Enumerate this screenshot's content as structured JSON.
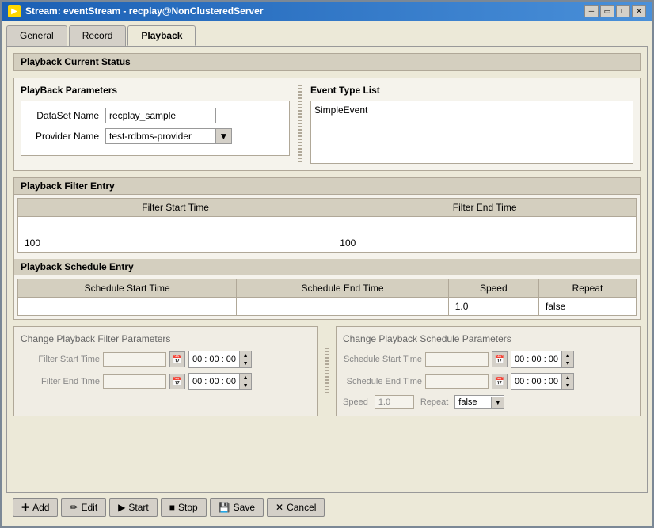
{
  "window": {
    "title": "Stream: eventStream - recplay@NonClusteredServer"
  },
  "tabs": [
    {
      "id": "general",
      "label": "General",
      "active": false
    },
    {
      "id": "record",
      "label": "Record",
      "active": false
    },
    {
      "id": "playback",
      "label": "Playback",
      "active": true
    }
  ],
  "playback_current_status": {
    "title": "Playback Current Status"
  },
  "playback_parameters": {
    "title": "PlayBack Parameters",
    "dataset_name_label": "DataSet Name",
    "dataset_name_value": "recplay_sample",
    "provider_name_label": "Provider Name",
    "provider_name_value": "test-rdbms-provider"
  },
  "event_type_list": {
    "title": "Event Type List",
    "items": [
      "SimpleEvent"
    ]
  },
  "filter_entry": {
    "title": "Playback Filter Entry",
    "col1": "Filter Start Time",
    "col2": "Filter End Time",
    "row1": {
      "start": "",
      "end": ""
    },
    "row2": {
      "start": "100",
      "end": "100"
    }
  },
  "schedule_entry": {
    "title": "Playback Schedule Entry",
    "cols": [
      "Schedule Start Time",
      "Schedule End Time",
      "Speed",
      "Repeat"
    ],
    "row": {
      "start": "",
      "end": "",
      "speed": "1.0",
      "repeat": "false"
    }
  },
  "change_filter": {
    "title": "Change Playback Filter Parameters",
    "filter_start_time_label": "Filter Start Time",
    "filter_end_time_label": "Filter End Time",
    "time_start": "00 : 00 : 00",
    "time_end": "00 : 00 : 00"
  },
  "change_schedule": {
    "title": "Change Playback Schedule Parameters",
    "schedule_start_time_label": "Schedule Start Time",
    "schedule_end_time_label": "Schedule End Time",
    "speed_label": "Speed",
    "speed_value": "1.0",
    "repeat_label": "Repeat",
    "repeat_value": "false",
    "time_start": "00 : 00 : 00",
    "time_end": "00 : 00 : 00"
  },
  "toolbar": {
    "add_label": "Add",
    "edit_label": "Edit",
    "start_label": "Start",
    "stop_label": "Stop",
    "save_label": "Save",
    "cancel_label": "Cancel"
  }
}
